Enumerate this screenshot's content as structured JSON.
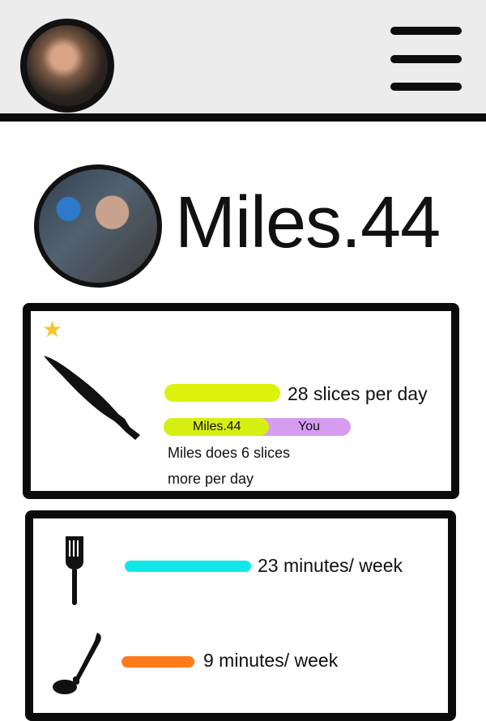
{
  "header": {
    "avatar_icon": "user-avatar-icon",
    "menu_icon": "hamburger-menu-icon"
  },
  "profile": {
    "username": "Miles.44",
    "avatar_icon": "profile-avatar-icon"
  },
  "cards": {
    "knife": {
      "badge_icon": "star-icon",
      "tool_icon": "knife-icon",
      "metric": "28 slices per day",
      "compare": {
        "left_label": "Miles.44",
        "right_label": "You"
      },
      "description": "Miles does 6 slices\nmore per day",
      "colors": {
        "primary": "#ddf20a",
        "secondary": "#d59cf0",
        "star": "#f7c52b"
      }
    },
    "cookware": {
      "spatula_icon": "spatula-icon",
      "spatula_metric": "23 minutes/ week",
      "ladle_icon": "ladle-icon",
      "ladle_metric": "9 minutes/ week",
      "colors": {
        "spatula": "#12e7e8",
        "ladle": "#ff7a1a"
      }
    }
  }
}
